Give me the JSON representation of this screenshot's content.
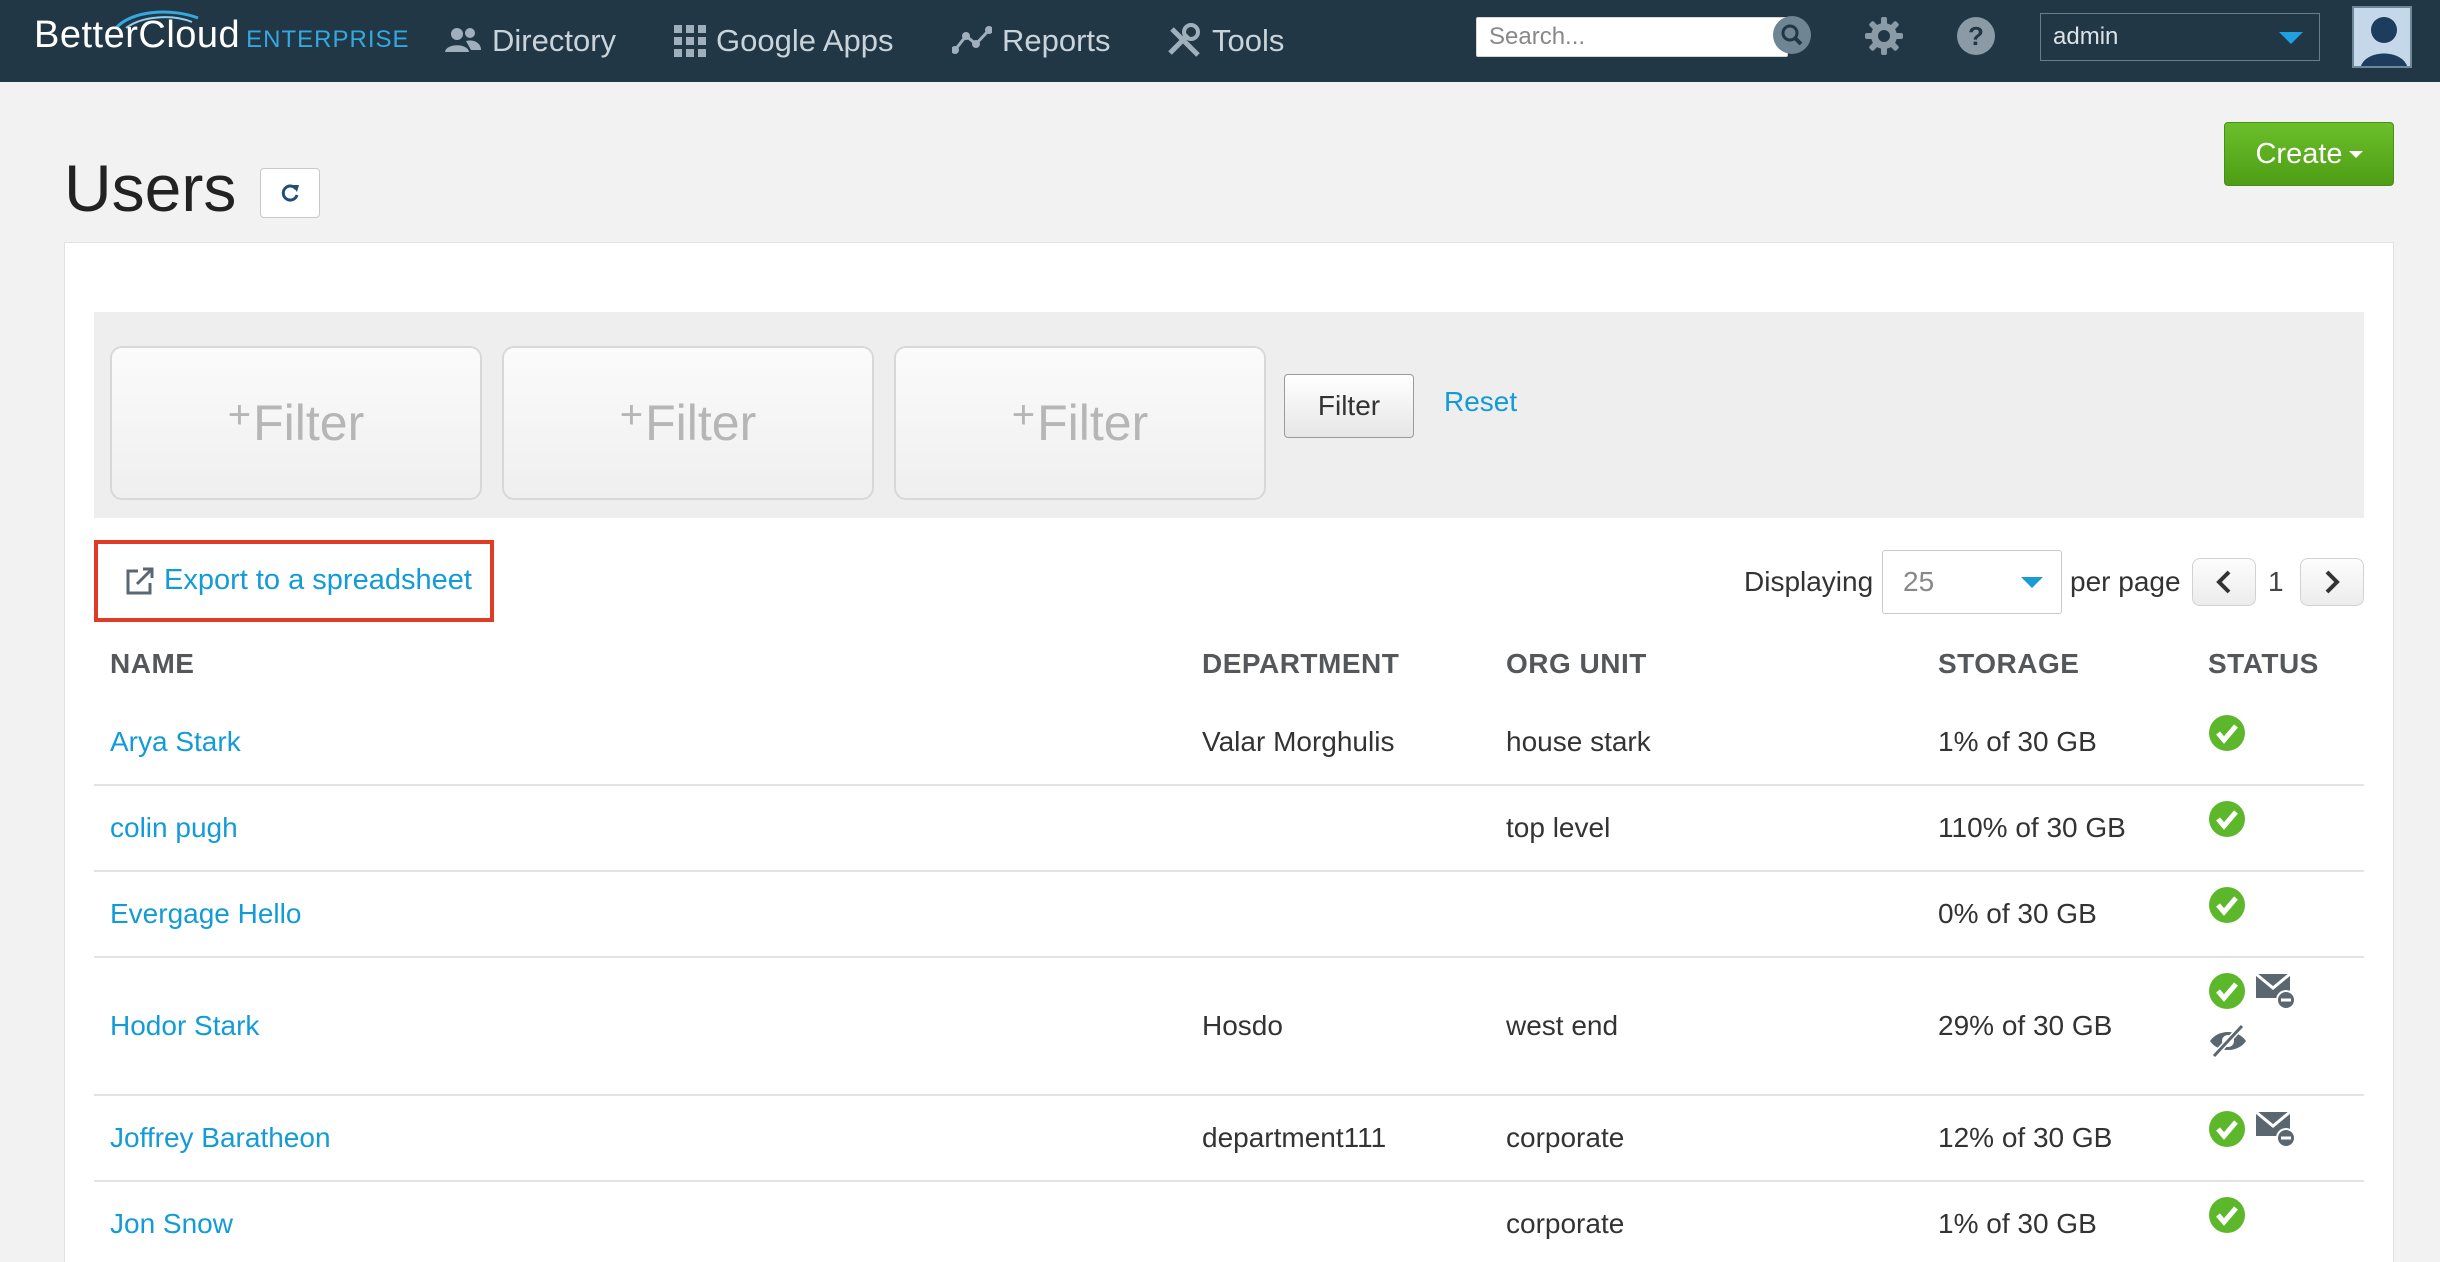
{
  "nav": {
    "brand_main": "BetterCloud",
    "brand_sub": "ENTERPRISE",
    "items": [
      {
        "label": "Directory",
        "icon": "users-icon"
      },
      {
        "label": "Google Apps",
        "icon": "grid-icon"
      },
      {
        "label": "Reports",
        "icon": "line-chart-icon"
      },
      {
        "label": "Tools",
        "icon": "tools-icon"
      }
    ],
    "search_placeholder": "Search...",
    "user_select": "admin"
  },
  "page": {
    "title": "Users",
    "create_label": "Create"
  },
  "filters": {
    "boxes": [
      "Filter",
      "Filter",
      "Filter"
    ],
    "plus": "+",
    "filter_button": "Filter",
    "reset_link": "Reset"
  },
  "toolbar": {
    "export_label": "Export to a spreadsheet",
    "displaying_label": "Displaying",
    "per_page_value": "25",
    "per_page_label": "per page",
    "current_page": "1"
  },
  "table": {
    "headers": [
      "NAME",
      "DEPARTMENT",
      "ORG UNIT",
      "STORAGE",
      "STATUS"
    ],
    "rows": [
      {
        "name": "Arya Stark",
        "department": "Valar Morghulis",
        "org_unit": "house stark",
        "storage": "1% of 30 GB",
        "status": [
          "active"
        ]
      },
      {
        "name": "colin pugh",
        "department": "",
        "org_unit": "top level",
        "storage": "110% of 30 GB",
        "status": [
          "active"
        ]
      },
      {
        "name": "Evergage Hello",
        "department": "",
        "org_unit": "",
        "storage": "0% of 30 GB",
        "status": [
          "active"
        ]
      },
      {
        "name": "Hodor Stark",
        "department": "Hosdo",
        "org_unit": "west end",
        "storage": "29% of 30 GB",
        "status": [
          "active",
          "mail-forward",
          "hidden"
        ]
      },
      {
        "name": "Joffrey Baratheon",
        "department": "department111",
        "org_unit": "corporate",
        "storage": "12% of 30 GB",
        "status": [
          "active",
          "mail-forward"
        ]
      },
      {
        "name": "Jon Snow",
        "department": "",
        "org_unit": "corporate",
        "storage": "1% of 30 GB",
        "status": [
          "active"
        ]
      }
    ]
  },
  "colors": {
    "navbar": "#213746",
    "link": "#139bd8",
    "create_green": "#5aac1e",
    "status_green": "#5cb82a",
    "highlight_red": "#e23b25"
  }
}
